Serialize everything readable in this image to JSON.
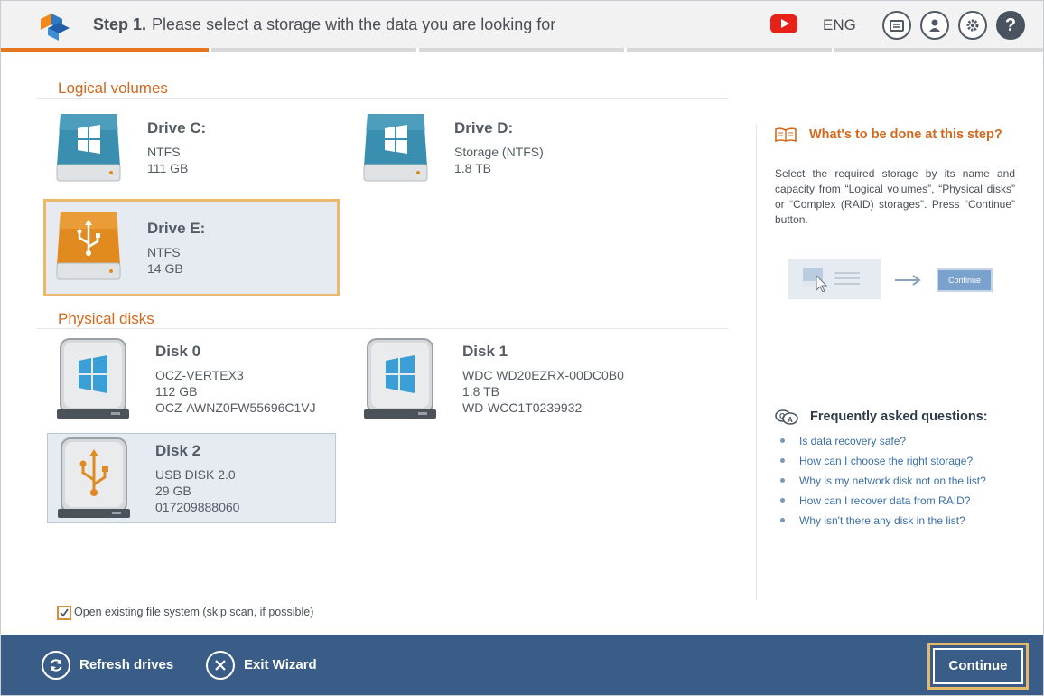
{
  "header": {
    "step_label": "Step 1.",
    "title": "Please select a storage with the data you are looking for",
    "language": "ENG",
    "icons": [
      "youtube-icon",
      "log-icon",
      "user-icon",
      "settings-icon",
      "help-icon"
    ]
  },
  "progress": {
    "completed_fraction": 0.2,
    "steps": 5
  },
  "logical_volumes": {
    "title": "Logical volumes",
    "items": [
      {
        "name": "Drive C:",
        "fs": "NTFS",
        "size": "111 GB",
        "icon": "windows-drive-icon"
      },
      {
        "name": "Drive D:",
        "fs": "Storage (NTFS)",
        "size": "1.8 TB",
        "icon": "windows-drive-icon"
      },
      {
        "name": "Drive E:",
        "fs": "NTFS",
        "size": "14 GB",
        "icon": "usb-drive-icon",
        "selected": true
      }
    ]
  },
  "physical_disks": {
    "title": "Physical disks",
    "items": [
      {
        "name": "Disk 0",
        "model": "OCZ-VERTEX3",
        "size": "112 GB",
        "serial": "OCZ-AWNZ0FW55696C1VJ",
        "icon": "windows-disk-icon"
      },
      {
        "name": "Disk 1",
        "model": "WDC WD20EZRX-00DC0B0",
        "size": "1.8 TB",
        "serial": "WD-WCC1T0239932",
        "icon": "windows-disk-icon"
      },
      {
        "name": "Disk 2",
        "model": "USB DISK 2.0",
        "size": "29 GB",
        "serial": "017209888060",
        "icon": "usb-disk-icon",
        "highlighted": true
      }
    ]
  },
  "help": {
    "title": "What's to be done at this step?",
    "text": "Select the required storage by its name and capacity from “Logical volumes”, “Physical disks” or “Complex (RAID) storages”. Press “Continue” button.",
    "illustration_button": "Continue"
  },
  "faq": {
    "title": "Frequently asked questions:",
    "items": [
      "Is data recovery safe?",
      "How can I choose the right storage?",
      "Why is my network disk not on the list?",
      "How can I recover data from RAID?",
      "Why isn't there any disk in the list?"
    ]
  },
  "options": {
    "open_existing_fs_label": "Open existing file system (skip scan, if possible)",
    "open_existing_fs_checked": true
  },
  "footer": {
    "refresh_label": "Refresh drives",
    "exit_label": "Exit Wizard",
    "continue_label": "Continue"
  },
  "colors": {
    "accent": "#e5761d",
    "footer_bg": "#3a5d88",
    "selection_border": "#eab96a",
    "volume_blue": "#3a8fb0",
    "volume_orange": "#e08a20"
  }
}
